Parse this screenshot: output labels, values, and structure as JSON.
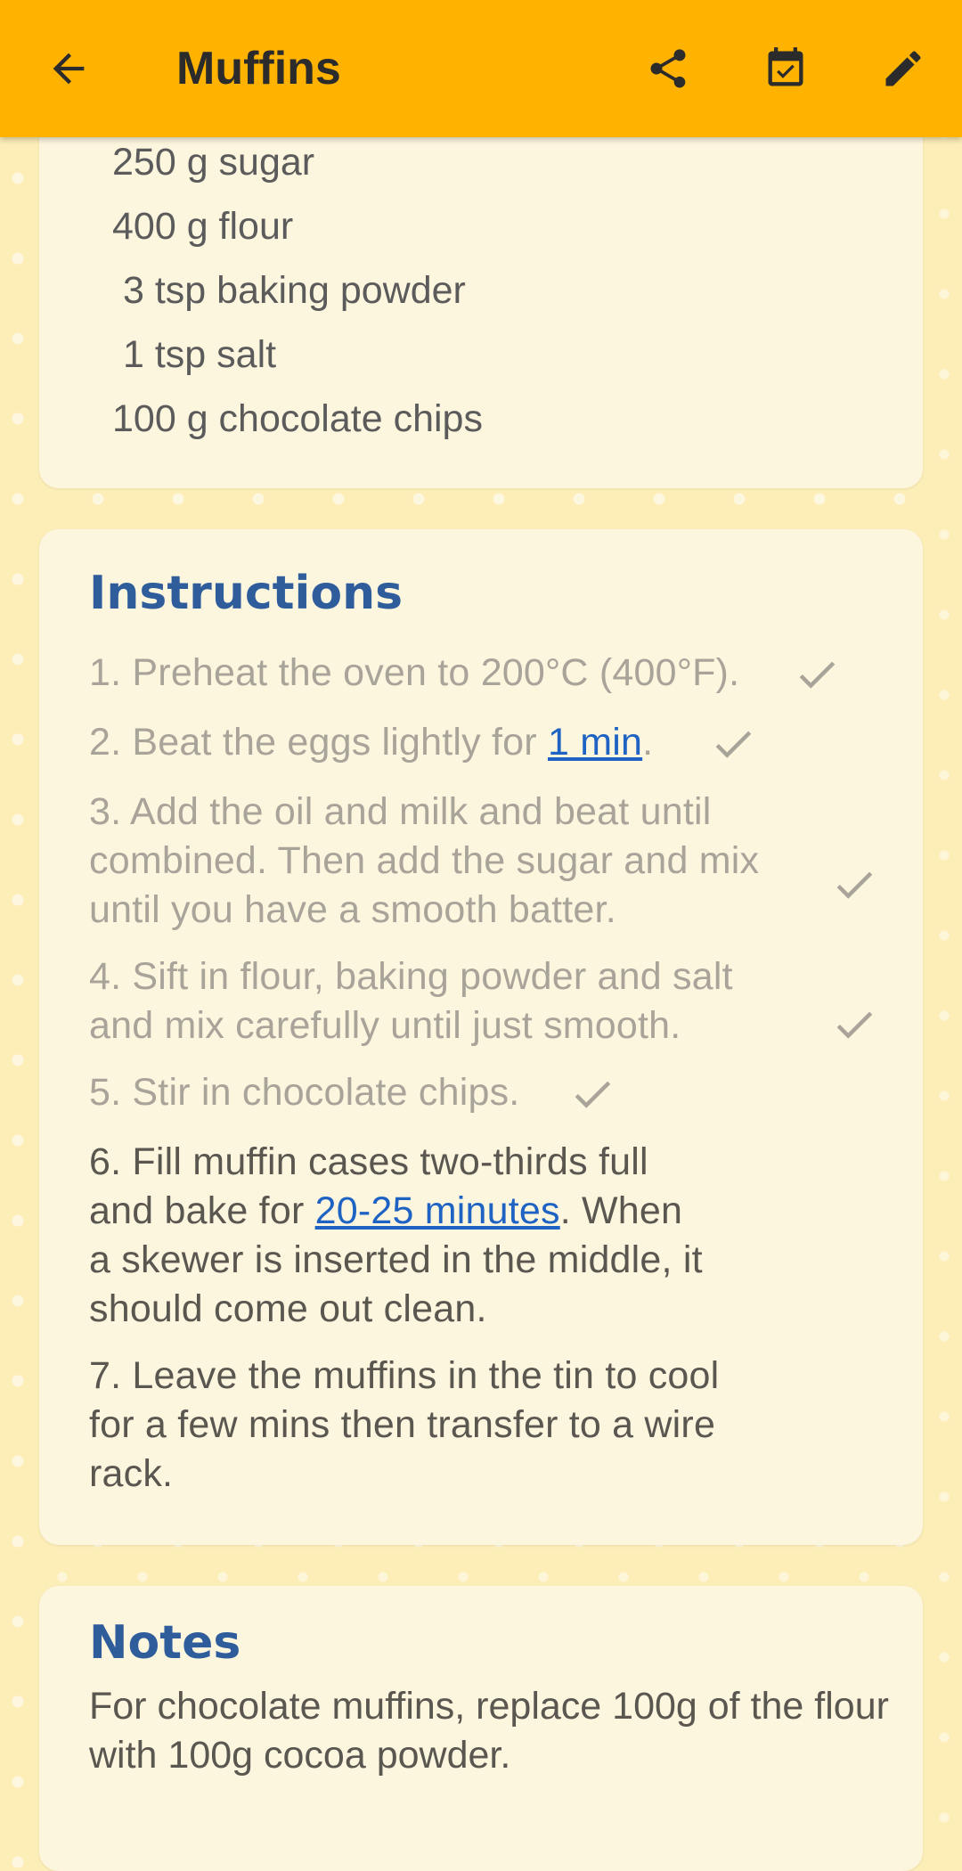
{
  "appbar": {
    "title": "Muffins",
    "background": "#ffb300",
    "icons": [
      "arrow-back-icon",
      "share-icon",
      "calendar-check-icon",
      "edit-pencil-icon"
    ]
  },
  "ingredients": [
    "250 g sugar",
    "400 g flour",
    "3 tsp baking powder",
    "1 tsp salt",
    "100 g chocolate chips"
  ],
  "instructions": {
    "title": "Instructions",
    "steps": [
      {
        "number": "1.",
        "text": "Preheat the oven to 200°C (400°F).",
        "done": true
      },
      {
        "number": "2.",
        "text_before": "Beat the eggs lightly for ",
        "link": "1 min",
        "text_after": ".",
        "done": true
      },
      {
        "number": "3.",
        "line1": "Add the oil and milk and beat until",
        "line2": "combined. Then add the sugar and mix",
        "line3": "until you have a smooth batter.",
        "done": true
      },
      {
        "number": "4.",
        "line1": "Sift in flour, baking powder and salt",
        "line2": "and mix carefully until just smooth.",
        "done": true
      },
      {
        "number": "5.",
        "text": "Stir in chocolate chips.",
        "done": true
      },
      {
        "number": "6.",
        "line1": "Fill muffin cases two-thirds full",
        "line2_before": "and bake for ",
        "link": "20-25 minutes",
        "line2_after": ". When",
        "line3": "a skewer is inserted in the middle, it",
        "line4": "should come out clean.",
        "done": false
      },
      {
        "number": "7.",
        "line1": "Leave the muffins in the tin to cool",
        "line2": "for a few mins then transfer to a wire",
        "line3": "rack.",
        "done": false
      }
    ]
  },
  "notes": {
    "title": "Notes",
    "text": "For chocolate muffins, replace 100g of the flour with 100g cocoa powder."
  },
  "colors": {
    "accent": "#ffb300",
    "heading": "#2f5d9c",
    "link": "#1e63c3",
    "done_text": "#a9a49a",
    "text": "#5a5650"
  }
}
